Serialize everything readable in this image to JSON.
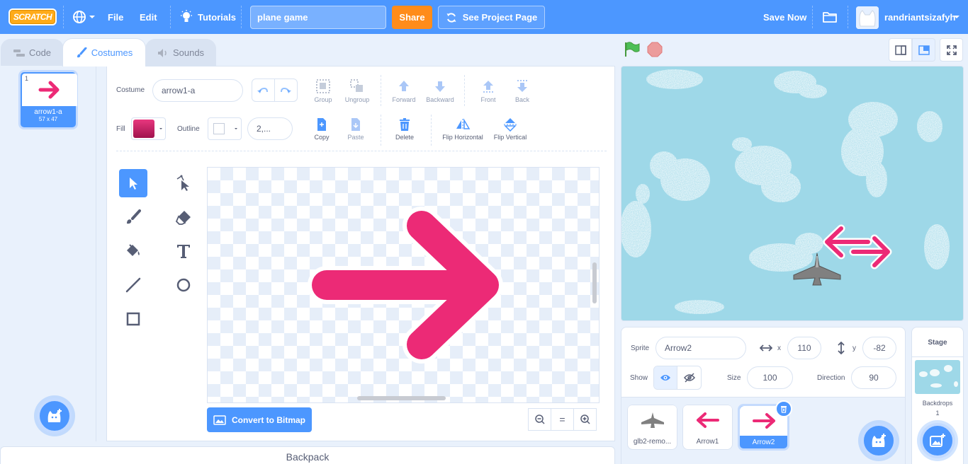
{
  "menu": {
    "logo": "SCRATCH",
    "file": "File",
    "edit": "Edit",
    "tutorials": "Tutorials",
    "project_title": "plane game",
    "share": "Share",
    "see_project_page": "See Project Page",
    "save_now": "Save Now",
    "username": "randriantsizafyh"
  },
  "tabs": {
    "code": "Code",
    "costumes": "Costumes",
    "sounds": "Sounds"
  },
  "costume_list": [
    {
      "number": "1",
      "name": "arrow1-a",
      "size": "57 x 47"
    }
  ],
  "paint": {
    "costume_label": "Costume",
    "costume_name": "arrow1-a",
    "fill_label": "Fill",
    "outline_label": "Outline",
    "outline_width": "2,...",
    "group": "Group",
    "ungroup": "Ungroup",
    "forward": "Forward",
    "backward": "Backward",
    "front": "Front",
    "back": "Back",
    "copy": "Copy",
    "paste": "Paste",
    "delete": "Delete",
    "flip_horizontal": "Flip Horizontal",
    "flip_vertical": "Flip Vertical",
    "convert": "Convert to Bitmap",
    "zoom_reset": "="
  },
  "colors": {
    "accent": "#4c97ff",
    "arrow": "#ec2a76",
    "fill_swatch": "#c8175f",
    "share": "#ff8c1a"
  },
  "backpack": "Backpack",
  "sprite": {
    "sprite_label": "Sprite",
    "name": "Arrow2",
    "x_label": "x",
    "x": "110",
    "y_label": "y",
    "y": "-82",
    "show_label": "Show",
    "size_label": "Size",
    "size": "100",
    "direction_label": "Direction",
    "direction": "90"
  },
  "sprites": [
    {
      "name": "glb2-remo..."
    },
    {
      "name": "Arrow1"
    },
    {
      "name": "Arrow2"
    }
  ],
  "stage_pane": {
    "title": "Stage",
    "backdrops_label": "Backdrops",
    "backdrops_count": "1"
  }
}
